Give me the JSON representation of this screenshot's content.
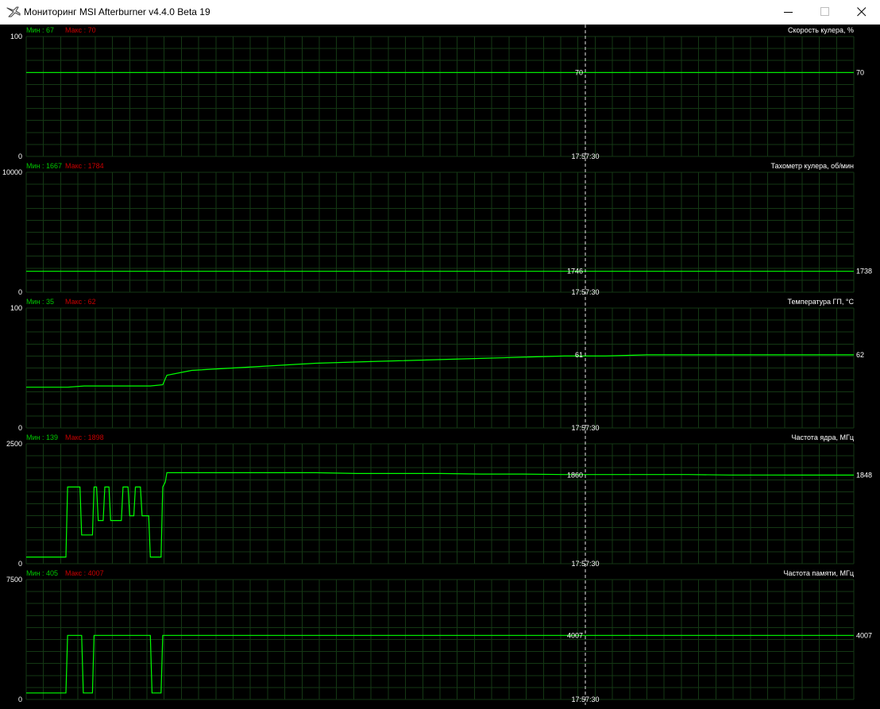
{
  "window": {
    "title": "Мониторинг MSI Afterburner v4.4.0 Beta 19",
    "app_icon": "afterburner-plane-icon"
  },
  "cursor_time": "17:57:30",
  "colors": {
    "background": "#000000",
    "grid": "#143814",
    "line": "#00ff00",
    "min_label": "#00c800",
    "max_label": "#c80000",
    "text": "#ffffff"
  },
  "chart_data": [
    {
      "type": "line",
      "title": "Скорость кулера, %",
      "min_label": "Мин : 67",
      "max_label": "Макс : 70",
      "ylim": [
        0,
        100
      ],
      "ymax_label": "100",
      "ymin_label": "0",
      "cursor_value": "70",
      "current_value": "70",
      "x": [
        0,
        1
      ],
      "values": [
        70,
        70
      ]
    },
    {
      "type": "line",
      "title": "Тахометр кулера, об/мин",
      "min_label": "Мин : 1667",
      "max_label": "Макс : 1784",
      "ylim": [
        0,
        10000
      ],
      "ymax_label": "10000",
      "ymin_label": "0",
      "cursor_value": "1746",
      "current_value": "1738",
      "x": [
        0,
        1
      ],
      "values": [
        1740,
        1740
      ]
    },
    {
      "type": "line",
      "title": "Температура ГП, °С",
      "min_label": "Мин : 35",
      "max_label": "Макс : 62",
      "ylim": [
        0,
        100
      ],
      "ymax_label": "100",
      "ymin_label": "0",
      "cursor_value": "61",
      "current_value": "62",
      "x": [
        0,
        0.05,
        0.07,
        0.1,
        0.15,
        0.165,
        0.17,
        0.2,
        0.25,
        0.3,
        0.35,
        0.4,
        0.45,
        0.5,
        0.55,
        0.6,
        0.65,
        0.7,
        0.75,
        0.8,
        0.85,
        0.9,
        0.95,
        1
      ],
      "values": [
        34,
        34,
        35,
        35,
        35,
        36,
        44,
        48,
        50,
        52,
        54,
        55,
        56,
        57,
        58,
        59,
        60,
        60,
        61,
        61,
        61,
        61,
        61,
        61
      ]
    },
    {
      "type": "line",
      "title": "Частота ядра, МГц",
      "min_label": "Мин : 139",
      "max_label": "Макс : 1898",
      "ylim": [
        0,
        2500
      ],
      "ymax_label": "2500",
      "ymin_label": "0",
      "cursor_value": "1860",
      "current_value": "1848",
      "x": [
        0,
        0.048,
        0.05,
        0.065,
        0.067,
        0.08,
        0.082,
        0.085,
        0.087,
        0.093,
        0.095,
        0.1,
        0.102,
        0.115,
        0.117,
        0.123,
        0.125,
        0.13,
        0.132,
        0.138,
        0.14,
        0.148,
        0.15,
        0.163,
        0.165,
        0.168,
        0.17,
        0.2,
        0.25,
        0.3,
        0.35,
        0.4,
        0.45,
        0.5,
        0.55,
        0.6,
        0.65,
        0.7,
        0.75,
        0.8,
        0.85,
        0.9,
        0.95,
        1
      ],
      "values": [
        139,
        139,
        1600,
        1600,
        600,
        600,
        1600,
        1600,
        900,
        900,
        1600,
        1600,
        900,
        900,
        1600,
        1600,
        1000,
        1000,
        1600,
        1600,
        1000,
        1000,
        139,
        139,
        1600,
        1700,
        1898,
        1898,
        1898,
        1898,
        1898,
        1880,
        1880,
        1880,
        1870,
        1870,
        1860,
        1860,
        1860,
        1860,
        1850,
        1850,
        1848,
        1848
      ]
    },
    {
      "type": "line",
      "title": "Частота памяти, МГц",
      "min_label": "Мин : 405",
      "max_label": "Макс : 4007",
      "ylim": [
        0,
        7500
      ],
      "ymax_label": "7500",
      "ymin_label": "0",
      "cursor_value": "4007",
      "current_value": "4007",
      "x": [
        0,
        0.048,
        0.05,
        0.067,
        0.069,
        0.08,
        0.082,
        0.15,
        0.152,
        0.163,
        0.165,
        0.2,
        0.3,
        0.4,
        0.5,
        0.6,
        0.7,
        0.8,
        0.9,
        1
      ],
      "values": [
        405,
        405,
        4007,
        4007,
        405,
        405,
        4007,
        4007,
        405,
        405,
        4007,
        4007,
        4007,
        4007,
        4007,
        4007,
        4007,
        4007,
        4007,
        4007
      ]
    }
  ]
}
